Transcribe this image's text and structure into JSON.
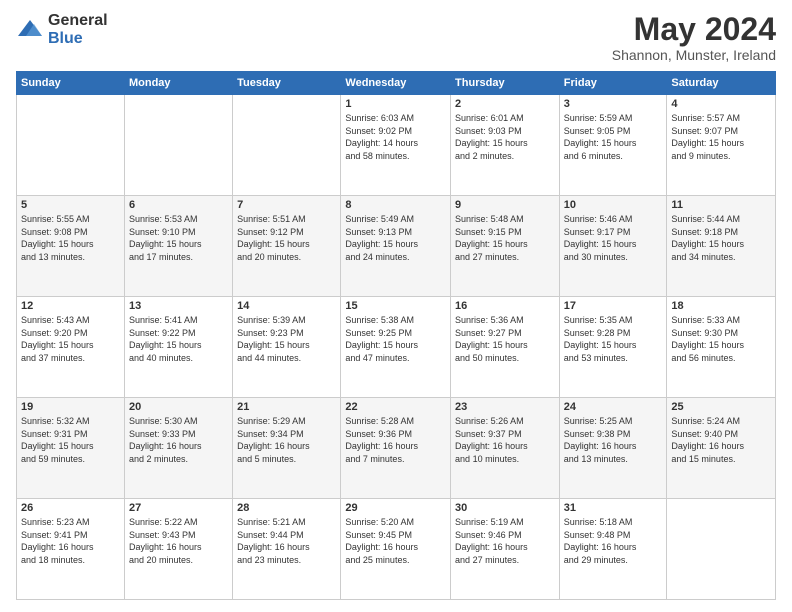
{
  "logo": {
    "general": "General",
    "blue": "Blue"
  },
  "title": "May 2024",
  "subtitle": "Shannon, Munster, Ireland",
  "days_of_week": [
    "Sunday",
    "Monday",
    "Tuesday",
    "Wednesday",
    "Thursday",
    "Friday",
    "Saturday"
  ],
  "weeks": [
    [
      {
        "day": "",
        "info": ""
      },
      {
        "day": "",
        "info": ""
      },
      {
        "day": "",
        "info": ""
      },
      {
        "day": "1",
        "info": "Sunrise: 6:03 AM\nSunset: 9:02 PM\nDaylight: 14 hours\nand 58 minutes."
      },
      {
        "day": "2",
        "info": "Sunrise: 6:01 AM\nSunset: 9:03 PM\nDaylight: 15 hours\nand 2 minutes."
      },
      {
        "day": "3",
        "info": "Sunrise: 5:59 AM\nSunset: 9:05 PM\nDaylight: 15 hours\nand 6 minutes."
      },
      {
        "day": "4",
        "info": "Sunrise: 5:57 AM\nSunset: 9:07 PM\nDaylight: 15 hours\nand 9 minutes."
      }
    ],
    [
      {
        "day": "5",
        "info": "Sunrise: 5:55 AM\nSunset: 9:08 PM\nDaylight: 15 hours\nand 13 minutes."
      },
      {
        "day": "6",
        "info": "Sunrise: 5:53 AM\nSunset: 9:10 PM\nDaylight: 15 hours\nand 17 minutes."
      },
      {
        "day": "7",
        "info": "Sunrise: 5:51 AM\nSunset: 9:12 PM\nDaylight: 15 hours\nand 20 minutes."
      },
      {
        "day": "8",
        "info": "Sunrise: 5:49 AM\nSunset: 9:13 PM\nDaylight: 15 hours\nand 24 minutes."
      },
      {
        "day": "9",
        "info": "Sunrise: 5:48 AM\nSunset: 9:15 PM\nDaylight: 15 hours\nand 27 minutes."
      },
      {
        "day": "10",
        "info": "Sunrise: 5:46 AM\nSunset: 9:17 PM\nDaylight: 15 hours\nand 30 minutes."
      },
      {
        "day": "11",
        "info": "Sunrise: 5:44 AM\nSunset: 9:18 PM\nDaylight: 15 hours\nand 34 minutes."
      }
    ],
    [
      {
        "day": "12",
        "info": "Sunrise: 5:43 AM\nSunset: 9:20 PM\nDaylight: 15 hours\nand 37 minutes."
      },
      {
        "day": "13",
        "info": "Sunrise: 5:41 AM\nSunset: 9:22 PM\nDaylight: 15 hours\nand 40 minutes."
      },
      {
        "day": "14",
        "info": "Sunrise: 5:39 AM\nSunset: 9:23 PM\nDaylight: 15 hours\nand 44 minutes."
      },
      {
        "day": "15",
        "info": "Sunrise: 5:38 AM\nSunset: 9:25 PM\nDaylight: 15 hours\nand 47 minutes."
      },
      {
        "day": "16",
        "info": "Sunrise: 5:36 AM\nSunset: 9:27 PM\nDaylight: 15 hours\nand 50 minutes."
      },
      {
        "day": "17",
        "info": "Sunrise: 5:35 AM\nSunset: 9:28 PM\nDaylight: 15 hours\nand 53 minutes."
      },
      {
        "day": "18",
        "info": "Sunrise: 5:33 AM\nSunset: 9:30 PM\nDaylight: 15 hours\nand 56 minutes."
      }
    ],
    [
      {
        "day": "19",
        "info": "Sunrise: 5:32 AM\nSunset: 9:31 PM\nDaylight: 15 hours\nand 59 minutes."
      },
      {
        "day": "20",
        "info": "Sunrise: 5:30 AM\nSunset: 9:33 PM\nDaylight: 16 hours\nand 2 minutes."
      },
      {
        "day": "21",
        "info": "Sunrise: 5:29 AM\nSunset: 9:34 PM\nDaylight: 16 hours\nand 5 minutes."
      },
      {
        "day": "22",
        "info": "Sunrise: 5:28 AM\nSunset: 9:36 PM\nDaylight: 16 hours\nand 7 minutes."
      },
      {
        "day": "23",
        "info": "Sunrise: 5:26 AM\nSunset: 9:37 PM\nDaylight: 16 hours\nand 10 minutes."
      },
      {
        "day": "24",
        "info": "Sunrise: 5:25 AM\nSunset: 9:38 PM\nDaylight: 16 hours\nand 13 minutes."
      },
      {
        "day": "25",
        "info": "Sunrise: 5:24 AM\nSunset: 9:40 PM\nDaylight: 16 hours\nand 15 minutes."
      }
    ],
    [
      {
        "day": "26",
        "info": "Sunrise: 5:23 AM\nSunset: 9:41 PM\nDaylight: 16 hours\nand 18 minutes."
      },
      {
        "day": "27",
        "info": "Sunrise: 5:22 AM\nSunset: 9:43 PM\nDaylight: 16 hours\nand 20 minutes."
      },
      {
        "day": "28",
        "info": "Sunrise: 5:21 AM\nSunset: 9:44 PM\nDaylight: 16 hours\nand 23 minutes."
      },
      {
        "day": "29",
        "info": "Sunrise: 5:20 AM\nSunset: 9:45 PM\nDaylight: 16 hours\nand 25 minutes."
      },
      {
        "day": "30",
        "info": "Sunrise: 5:19 AM\nSunset: 9:46 PM\nDaylight: 16 hours\nand 27 minutes."
      },
      {
        "day": "31",
        "info": "Sunrise: 5:18 AM\nSunset: 9:48 PM\nDaylight: 16 hours\nand 29 minutes."
      },
      {
        "day": "",
        "info": ""
      }
    ]
  ]
}
